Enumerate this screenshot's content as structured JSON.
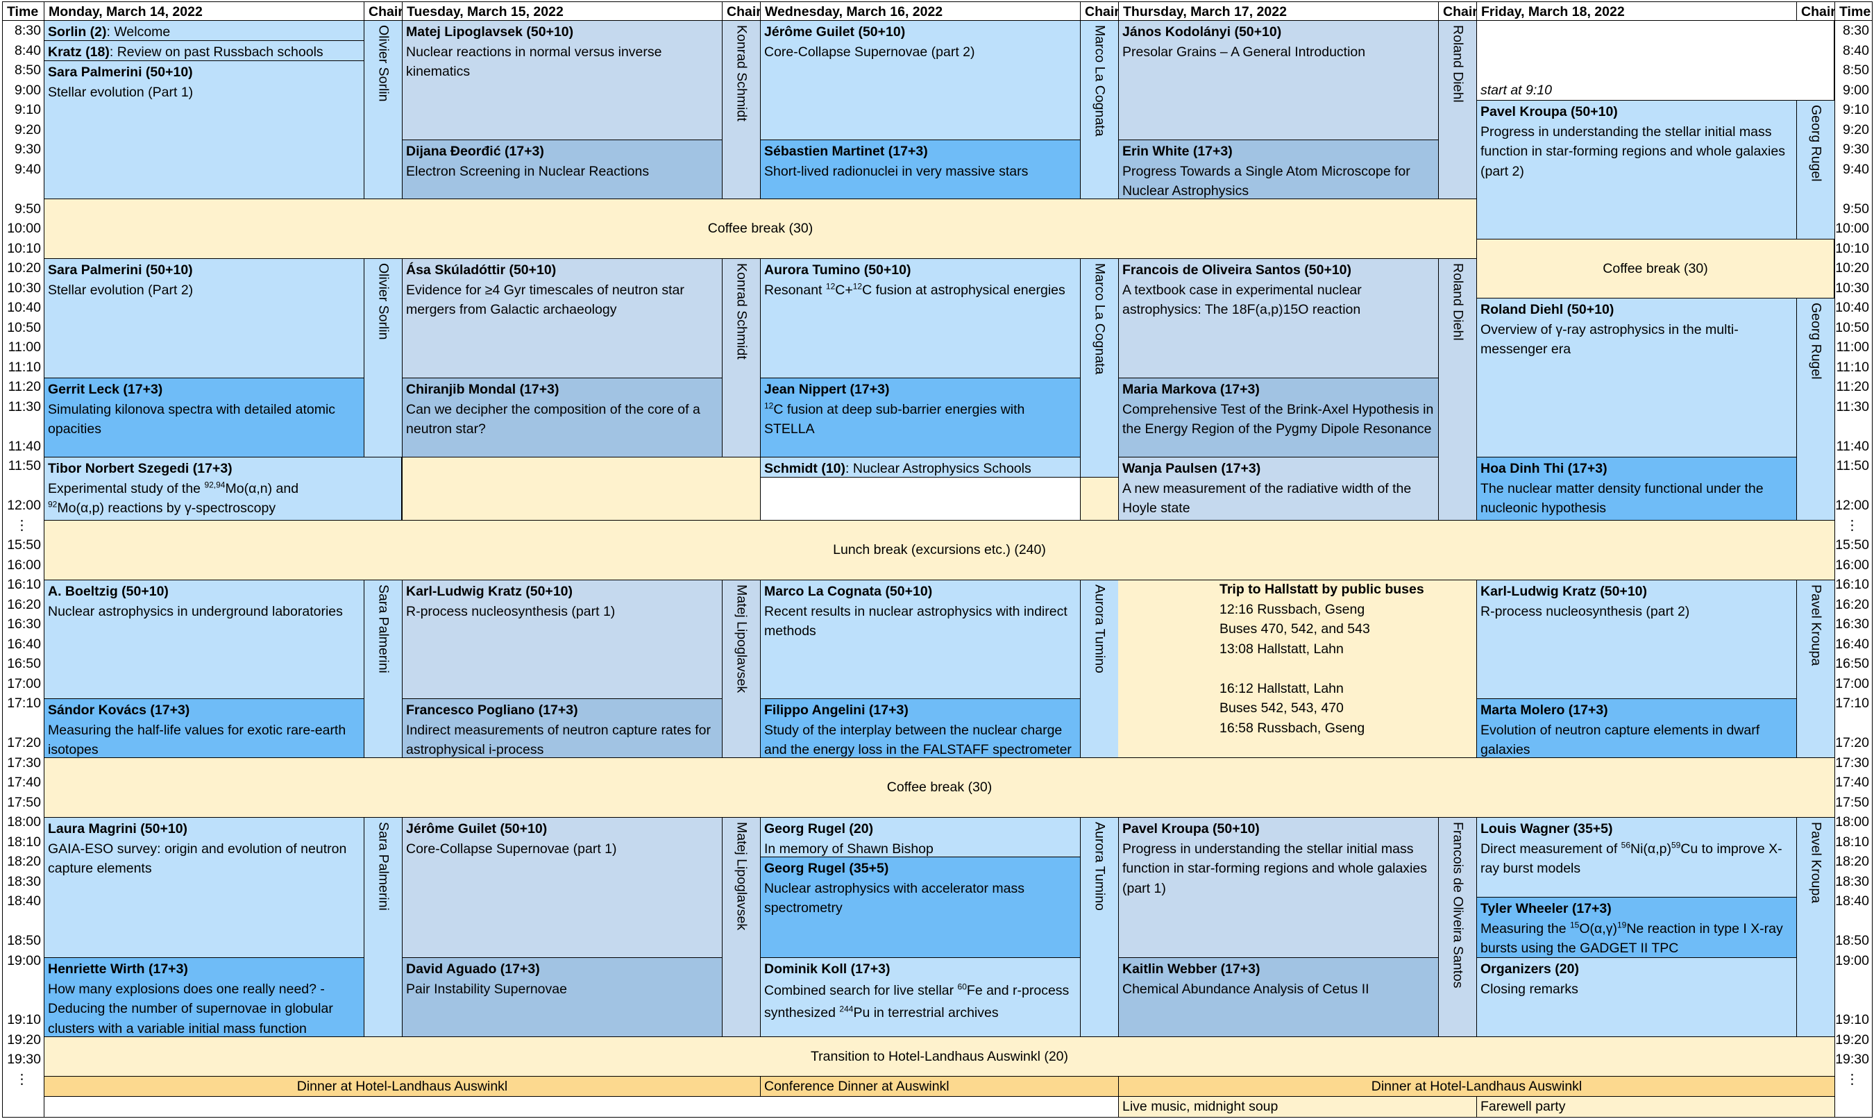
{
  "headers": {
    "time": "Time",
    "monday": "Monday, March 14, 2022",
    "chair": "Chair",
    "tuesday": "Tuesday, March 15, 2022",
    "wednesday": "Wednesday, March 16, 2022",
    "thursday": "Thursday, March 17, 2022",
    "friday": "Friday, March 18, 2022"
  },
  "time_slots": [
    "8:30",
    "8:40",
    "8:50",
    "9:00",
    "9:10",
    "9:20",
    "9:30",
    "9:40",
    "",
    "9:50",
    "10:00",
    "10:10",
    "10:20",
    "10:30",
    "10:40",
    "10:50",
    "11:00",
    "11:10",
    "11:20",
    "11:30",
    "",
    "11:40",
    "11:50",
    "",
    "12:00",
    "⋮",
    "15:50",
    "16:00",
    "16:10",
    "16:20",
    "16:30",
    "16:40",
    "16:50",
    "17:00",
    "17:10",
    "",
    "17:20",
    "17:30",
    "17:40",
    "17:50",
    "18:00",
    "18:10",
    "18:20",
    "18:30",
    "18:40",
    "",
    "18:50",
    "19:00",
    "",
    "",
    "19:10",
    "19:20",
    "19:30",
    "⋮"
  ],
  "chairs": {
    "mon_am": "Olivier Sorlin",
    "tue_am": "Konrad Schmidt",
    "wed_am": "Marco La Cognata",
    "thu_am": "Roland Diehl",
    "fri_am": "Georg Rugel",
    "mon_pm": "Sara Palmerini",
    "tue_pm": "Matej Lipoglavsek",
    "wed_pm": "Aurora Tumino",
    "thu_eve": "Francois de Oliveira Santos",
    "fri_pm": "Pavel Kroupa"
  },
  "breaks": {
    "coffee1": "Coffee break (30)",
    "coffee_fri": "Coffee break (30)",
    "lunch": "Lunch break (excursions etc.) (240)",
    "coffee2": "Coffee break (30)",
    "transition": "Transition to Hotel-Landhaus Auswinkl (20)",
    "dinner1": "Dinner at Hotel-Landhaus Auswinkl",
    "dinner2": "Conference Dinner at Auswinkl",
    "dinner3": "Dinner at Hotel-Landhaus Auswinkl",
    "music": "Live music, midnight soup",
    "farewell": "Farewell party"
  },
  "talks": {
    "mon_sorlin": {
      "speaker": "Sorlin (2)",
      "title": ": Welcome"
    },
    "mon_kratz": {
      "speaker": "Kratz (18)",
      "title": ": Review on past Russbach schools"
    },
    "mon_palmerini1": {
      "speaker": "Sara Palmerini (50+10)",
      "title": "Stellar evolution (Part 1)"
    },
    "mon_palmerini2": {
      "speaker": "Sara Palmerini (50+10)",
      "title": "Stellar evolution (Part 2)"
    },
    "mon_leck": {
      "speaker": "Gerrit Leck (17+3)",
      "title": "Simulating kilonova spectra with detailed atomic opacities"
    },
    "mon_szegedi": {
      "speaker": "Tibor Norbert Szegedi (17+3)",
      "title_a": "Experimental study of the ",
      "sup_a": "92,94",
      "title_b": "Mo(α,n) and ",
      "sup_b": "92",
      "title_c": "Mo(α,p) reactions by γ-spectroscopy"
    },
    "mon_boeltzig": {
      "speaker": "A. Boeltzig (50+10)",
      "title": "Nuclear astrophysics in underground laboratories"
    },
    "mon_kovacs": {
      "speaker": "Sándor Kovács (17+3)",
      "title": "Measuring the half-life values for exotic rare-earth isotopes"
    },
    "mon_magrini": {
      "speaker": "Laura Magrini (50+10)",
      "title": "GAIA-ESO survey: origin and evolution of neutron capture elements"
    },
    "mon_wirth": {
      "speaker": "Henriette Wirth (17+3)",
      "title": "How many explosions does one really need? - Deducing the number of supernovae in globular clusters with a variable initial mass function"
    },
    "tue_lipoglavsek": {
      "speaker": "Matej Lipoglavsek (50+10)",
      "title": "Nuclear reactions in normal versus inverse kinematics"
    },
    "tue_deordic": {
      "speaker": "Dijana Ðeorđić (17+3)",
      "title": "Electron Screening in Nuclear Reactions"
    },
    "tue_skuladottir": {
      "speaker": "Ása Skúladóttir (50+10)",
      "title": "Evidence for ≥4 Gyr timescales of neutron star mergers from Galactic archaeology"
    },
    "tue_mondal": {
      "speaker": "Chiranjib Mondal (17+3)",
      "title": "Can we decipher the composition of the core of a neutron star?"
    },
    "tue_kratz1": {
      "speaker": "Karl-Ludwig Kratz (50+10)",
      "title": "R-process nucleosynthesis (part 1)"
    },
    "tue_pogliano": {
      "speaker": "Francesco Pogliano (17+3)",
      "title": "Indirect measurements of neutron capture rates for astrophysical i-process"
    },
    "tue_guilet1": {
      "speaker": "Jérôme Guilet (50+10)",
      "title": "Core-Collapse Supernovae (part 1)"
    },
    "tue_aguado": {
      "speaker": "David Aguado (17+3)",
      "title": "Pair Instability Supernovae"
    },
    "wed_guilet2": {
      "speaker": "Jérôme Guilet (50+10)",
      "title": "Core-Collapse Supernovae (part 2)"
    },
    "wed_martinet": {
      "speaker": "Sébastien Martinet (17+3)",
      "title": "Short-lived radionuclei in very massive stars"
    },
    "wed_tumino": {
      "speaker": "Aurora Tumino (50+10)",
      "title_a": "Resonant ",
      "sup_a": "12",
      "title_b": "C+",
      "sup_b": "12",
      "title_c": "C fusion at astrophysical energies"
    },
    "wed_nippert": {
      "speaker": "Jean Nippert (17+3)",
      "sup_a": "12",
      "title_a": "C fusion at deep sub-barrier energies with STELLA"
    },
    "wed_schmidt": {
      "speaker": "Schmidt (10)",
      "title": ": Nuclear Astrophysics Schools"
    },
    "wed_lacognata": {
      "speaker": "Marco La Cognata (50+10)",
      "title": "Recent results in nuclear astrophysics with indirect methods"
    },
    "wed_angelini": {
      "speaker": "Filippo Angelini (17+3)",
      "title": "Study of the interplay between the nuclear charge and the energy loss in the FALSTAFF spectrometer"
    },
    "wed_rugel20": {
      "speaker": "Georg Rugel (20)",
      "title": "In memory of Shawn Bishop"
    },
    "wed_rugel35": {
      "speaker": "Georg Rugel (35+5)",
      "title": "Nuclear astrophysics with accelerator mass spectrometry"
    },
    "wed_koll": {
      "speaker": "Dominik Koll (17+3)",
      "title_a": "Combined search for live stellar ",
      "sup_a": "60",
      "title_b": "Fe and r-process synthesized ",
      "sup_b": "244",
      "title_c": "Pu in terrestrial archives"
    },
    "thu_kodolanyi": {
      "speaker": "János Kodolányi (50+10)",
      "title": "Presolar Grains – A General Introduction"
    },
    "thu_white": {
      "speaker": "Erin White (17+3)",
      "title": "Progress Towards a Single Atom Microscope for Nuclear Astrophysics"
    },
    "thu_santos": {
      "speaker": "Francois de Oliveira Santos (50+10)",
      "title": "A textbook case in experimental nuclear astrophysics: The 18F(a,p)15O reaction"
    },
    "thu_markova": {
      "speaker": "Maria Markova (17+3)",
      "title": "Comprehensive Test of the Brink-Axel Hypothesis in the Energy Region of the Pygmy Dipole Resonance"
    },
    "thu_paulsen": {
      "speaker": "Wanja Paulsen (17+3)",
      "title": "A new measurement of the radiative width of the Hoyle state"
    },
    "thu_kroupa1": {
      "speaker": "Pavel Kroupa (50+10)",
      "title": "Progress in understanding the stellar initial mass function in star-forming regions and whole galaxies (part 1)"
    },
    "thu_webber": {
      "speaker": "Kaitlin Webber (17+3)",
      "title": "Chemical Abundance Analysis of Cetus II"
    },
    "fri_kroupa2": {
      "speaker": "Pavel Kroupa (50+10)",
      "title": "Progress in understanding the stellar initial mass function in star-forming regions and whole galaxies (part 2)"
    },
    "fri_diehl": {
      "speaker": "Roland Diehl (50+10)",
      "title": "Overview of γ-ray astrophysics in the multi-messenger era"
    },
    "fri_hoa": {
      "speaker": "Hoa Dinh Thi (17+3)",
      "title": "The nuclear matter density functional under the nucleonic hypothesis"
    },
    "fri_kratz2": {
      "speaker": "Karl-Ludwig Kratz (50+10)",
      "title": "R-process nucleosynthesis (part 2)"
    },
    "fri_molero": {
      "speaker": "Marta Molero (17+3)",
      "title": "Evolution of neutron capture elements in dwarf galaxies"
    },
    "fri_wagner": {
      "speaker": "Louis Wagner (35+5)",
      "title_a": "Direct measurement of ",
      "sup_a": "56",
      "title_b": "Ni(α,p)",
      "sup_b": "59",
      "title_c": "Cu to improve X-ray burst models"
    },
    "fri_wheeler": {
      "speaker": "Tyler Wheeler (17+3)",
      "title_a": "Measuring the ",
      "sup_a": "15",
      "title_b": "O(α,γ)",
      "sup_b": "19",
      "title_c": "Ne reaction in type I X-ray bursts using the GADGET II TPC"
    },
    "fri_organizers": {
      "speaker": "Organizers (20)",
      "title": "Closing remarks"
    }
  },
  "notes": {
    "fri_start": "start at 9:10",
    "trip_title": "Trip to Hallstatt by public buses",
    "trip_lines": [
      "12:16 Russbach, Gseng",
      "Buses 470, 542, and 543",
      "13:08 Hallstatt, Lahn",
      "",
      "16:12 Hallstatt, Lahn",
      "Buses 542, 543, 470",
      "16:58 Russbach, Gseng"
    ]
  },
  "colors": {
    "light_blue": "#bde0fb",
    "grey_blue": "#c5d9ee",
    "strong_blue": "#6fbcf7",
    "steel_blue": "#a1c3e3",
    "break_tan": "#fef2cd",
    "dinner_gold": "#fcd98f"
  }
}
